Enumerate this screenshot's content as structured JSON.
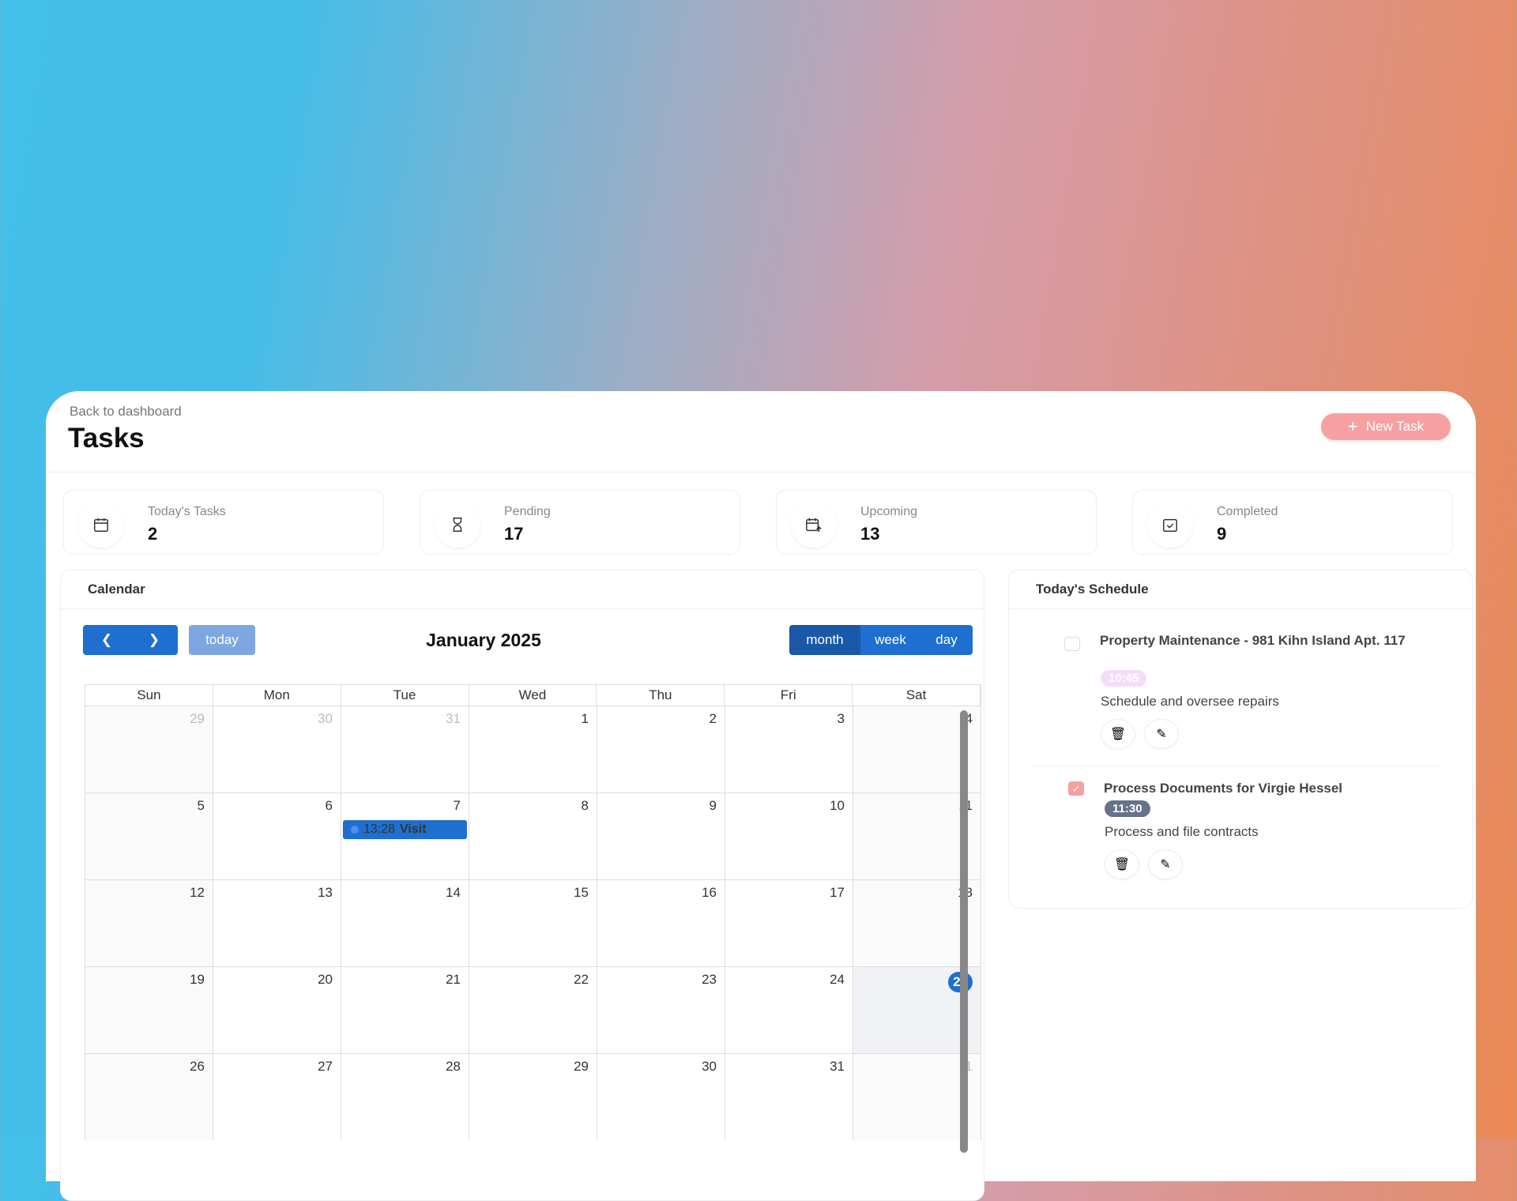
{
  "header": {
    "back_link": "Back to dashboard",
    "title": "Tasks",
    "new_task_label": "New Task"
  },
  "stats": [
    {
      "label": "Today's Tasks",
      "value": "2",
      "icon": "calendar-icon"
    },
    {
      "label": "Pending",
      "value": "17",
      "icon": "hourglass-icon"
    },
    {
      "label": "Upcoming",
      "value": "13",
      "icon": "calendar-arrow-icon"
    },
    {
      "label": "Completed",
      "value": "9",
      "icon": "calendar-check-icon"
    }
  ],
  "calendar": {
    "title": "Calendar",
    "today_label": "today",
    "month_title": "January 2025",
    "views": [
      "month",
      "week",
      "day"
    ],
    "active_view": "month",
    "weekdays": [
      "Sun",
      "Mon",
      "Tue",
      "Wed",
      "Thu",
      "Fri",
      "Sat"
    ],
    "weeks": [
      [
        "29",
        "30",
        "31",
        "1",
        "2",
        "3",
        "4"
      ],
      [
        "5",
        "6",
        "7",
        "8",
        "9",
        "10",
        "11"
      ],
      [
        "12",
        "13",
        "14",
        "15",
        "16",
        "17",
        "18"
      ],
      [
        "19",
        "20",
        "21",
        "22",
        "23",
        "24",
        "25"
      ],
      [
        "26",
        "27",
        "28",
        "29",
        "30",
        "31",
        "1"
      ]
    ],
    "today": "25",
    "event": {
      "time": "13:28",
      "title": "Visit",
      "day": "7"
    },
    "accent": "#1e6fd0"
  },
  "schedule": {
    "title": "Today's Schedule",
    "items": [
      {
        "title": "Property Maintenance - 981 Kihn Island Apt. 117",
        "time": "10:45",
        "description": "Schedule and oversee repairs",
        "done": false
      },
      {
        "title": "Process Documents for Virgie Hessel",
        "time": "11:30",
        "description": "Process and file contracts",
        "done": true
      }
    ]
  }
}
